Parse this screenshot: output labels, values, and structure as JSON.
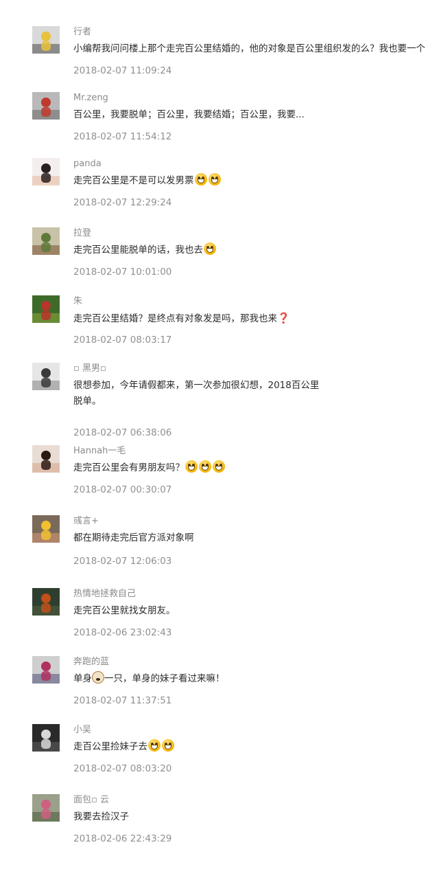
{
  "comments": [
    {
      "nickname": "行者",
      "text_lines": [
        "小编帮我问问楼上那个走完百公里结婚的，他的对象是百公里组织发的么？我也要一个"
      ],
      "time": "2018-02-07 11:09:24",
      "avatar_colors": [
        "#d9d9d9",
        "#e8c23a",
        "#6a6a6a"
      ]
    },
    {
      "nickname": "Mr.zeng",
      "text_lines": [
        "百公里，我要脱单；百公里，我要结婚；百公里，我要..."
      ],
      "time": "2018-02-07 11:54:12",
      "avatar_colors": [
        "#b9b9b9",
        "#c0392b",
        "#7a7a7a"
      ]
    },
    {
      "nickname": "panda",
      "text_lines": [
        "走完百公里是不是可以发男票"
      ],
      "emojis_after": 2,
      "time": "2018-02-07 12:29:24",
      "avatar_colors": [
        "#f4eeee",
        "#2a1f1f",
        "#e8c4b0"
      ]
    },
    {
      "nickname": "拉登",
      "text_lines": [
        "走完百公里能脱单的话，我也去"
      ],
      "emojis_after": 1,
      "time": "2018-02-07 10:01:00",
      "avatar_colors": [
        "#c8c2a8",
        "#5e7a3a",
        "#8a6a4a"
      ]
    },
    {
      "nickname": "朱",
      "text_lines": [
        "走完百公里结婚？是终点有对象发是吗，那我也来"
      ],
      "question_mark": "❓",
      "time": "2018-02-07 08:03:17",
      "avatar_colors": [
        "#3f6b2a",
        "#b8352a",
        "#7c9a3a"
      ]
    },
    {
      "nickname": "▫ 黑男▫",
      "text_lines": [
        "很想参加，今年请假都来，第一次参加很幻想，2018百公里",
        "脱单。"
      ],
      "time": "2018-02-07 06:38:06",
      "avatar_colors": [
        "#e6e6e6",
        "#3a3a3a",
        "#9a9a9a"
      ]
    },
    {
      "nickname": "Hannah一毛",
      "text_lines": [
        "走完百公里会有男朋友吗？"
      ],
      "emojis_after": 3,
      "time": "2018-02-07 00:30:07",
      "avatar_colors": [
        "#e9dcd4",
        "#2b1a14",
        "#d8b09a"
      ]
    },
    {
      "nickname": "彧言+",
      "text_lines": [
        "都在期待走完后官方派对象啊"
      ],
      "time": "2018-02-07 12:06:03",
      "avatar_colors": [
        "#7a6a5a",
        "#f2c030",
        "#c89070"
      ]
    },
    {
      "nickname": "热情地拯救自己",
      "text_lines": [
        "走完百公里就找女朋友。"
      ],
      "time": "2018-02-06 23:02:43",
      "avatar_colors": [
        "#2f3f2f",
        "#c0501a",
        "#4a5a3a"
      ]
    },
    {
      "nickname": "奔跑的蓝",
      "text_lines": [
        "单身",
        "一只，单身的妹子看过来嘛！"
      ],
      "time": "2018-02-07 11:37:51",
      "avatar_colors": [
        "#cfcfcf",
        "#b03060",
        "#6a6a8a"
      ]
    },
    {
      "nickname": "小吴",
      "text_lines": [
        "走百公里捡妹子去"
      ],
      "emojis_after": 2,
      "time": "2018-02-07 08:03:20",
      "avatar_colors": [
        "#2a2a2a",
        "#d8d8d8",
        "#555555"
      ]
    },
    {
      "nickname": "面包▫ 云",
      "text_lines": [
        "我要去捡汉子"
      ],
      "time": "2018-02-06 22:43:29",
      "avatar_colors": [
        "#9aa08a",
        "#d06080",
        "#5a6a4a"
      ]
    }
  ]
}
